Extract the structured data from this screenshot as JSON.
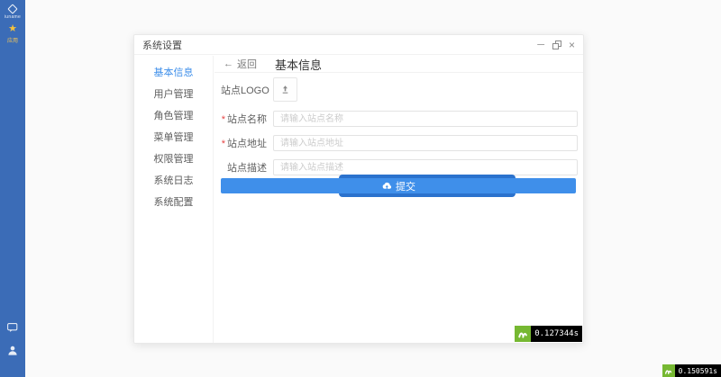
{
  "icons": {
    "star": "★",
    "minimize": "─",
    "close": "×",
    "back_arrow": "←"
  },
  "sidebar": {
    "brand_name": "iuname",
    "app_label": "应用"
  },
  "modal": {
    "title": "系统设置",
    "menu_items": [
      {
        "label": "基本信息",
        "active": true
      },
      {
        "label": "用户管理",
        "active": false
      },
      {
        "label": "角色管理",
        "active": false
      },
      {
        "label": "菜单管理",
        "active": false
      },
      {
        "label": "权限管理",
        "active": false
      },
      {
        "label": "系统日志",
        "active": false
      },
      {
        "label": "系统配置",
        "active": false
      }
    ],
    "content": {
      "back_label": "返回",
      "title": "基本信息",
      "form": {
        "required_mark": "*",
        "logo_label": "站点LOGO",
        "name_label": "站点名称",
        "name_placeholder": "请输入站点名称",
        "url_label": "站点地址",
        "url_placeholder": "请输入站点地址",
        "desc_label": "站点描述",
        "desc_placeholder": "请输入站点描述",
        "submit_label": "提交"
      }
    },
    "debug_time": "0.127344s"
  },
  "page_debug_time": "0.150591s",
  "colors": {
    "sidebar_blue": "#3b6cb7",
    "accent_blue": "#3f8fea",
    "submit_shadow_blue": "#2b72cd",
    "star_yellow": "#f5c23c",
    "required_red": "#e64545",
    "badge_green": "#76b832",
    "badge_black": "#000000"
  }
}
